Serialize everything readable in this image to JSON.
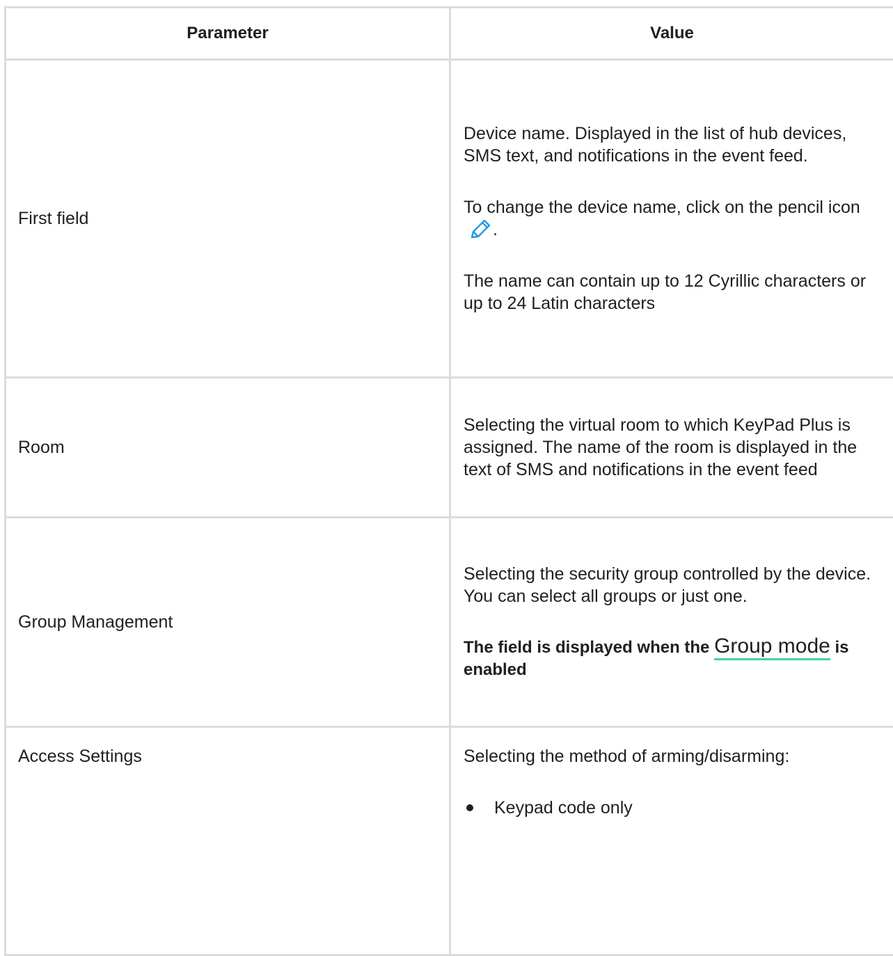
{
  "table": {
    "headers": {
      "parameter": "Parameter",
      "value": "Value"
    },
    "rows": {
      "first_field": {
        "param": "First field",
        "value_p1": "Device name. Displayed in the list of hub devices, SMS text, and notifications in the event feed.",
        "value_p2_text": "To change the device name, click on the pencil icon",
        "value_p2_end": ".",
        "value_p3": "The name can contain up to 12 Cyrillic characters or up to 24 Latin characters",
        "icon": "pencil-icon"
      },
      "room": {
        "param": "Room",
        "value": "Selecting the virtual room to which KeyPad Plus is assigned. The name of the room is displayed in the text of SMS and notifications in the event feed"
      },
      "group_management": {
        "param": "Group Management",
        "value_p1": "Selecting the security group controlled by the device. You can select all groups or just one.",
        "note_before": "The field is displayed when the",
        "note_link": "Group mode",
        "note_after": "is enabled"
      },
      "access_settings": {
        "param": "Access Settings",
        "value_p1": "Selecting the method of arming/disarming:",
        "methods": [
          "Keypad code only"
        ]
      }
    }
  },
  "colors": {
    "border": "#dcdcdc",
    "text": "#1f1f1f",
    "icon_blue": "#1e9be8",
    "link_underline": "#46d3a0"
  }
}
